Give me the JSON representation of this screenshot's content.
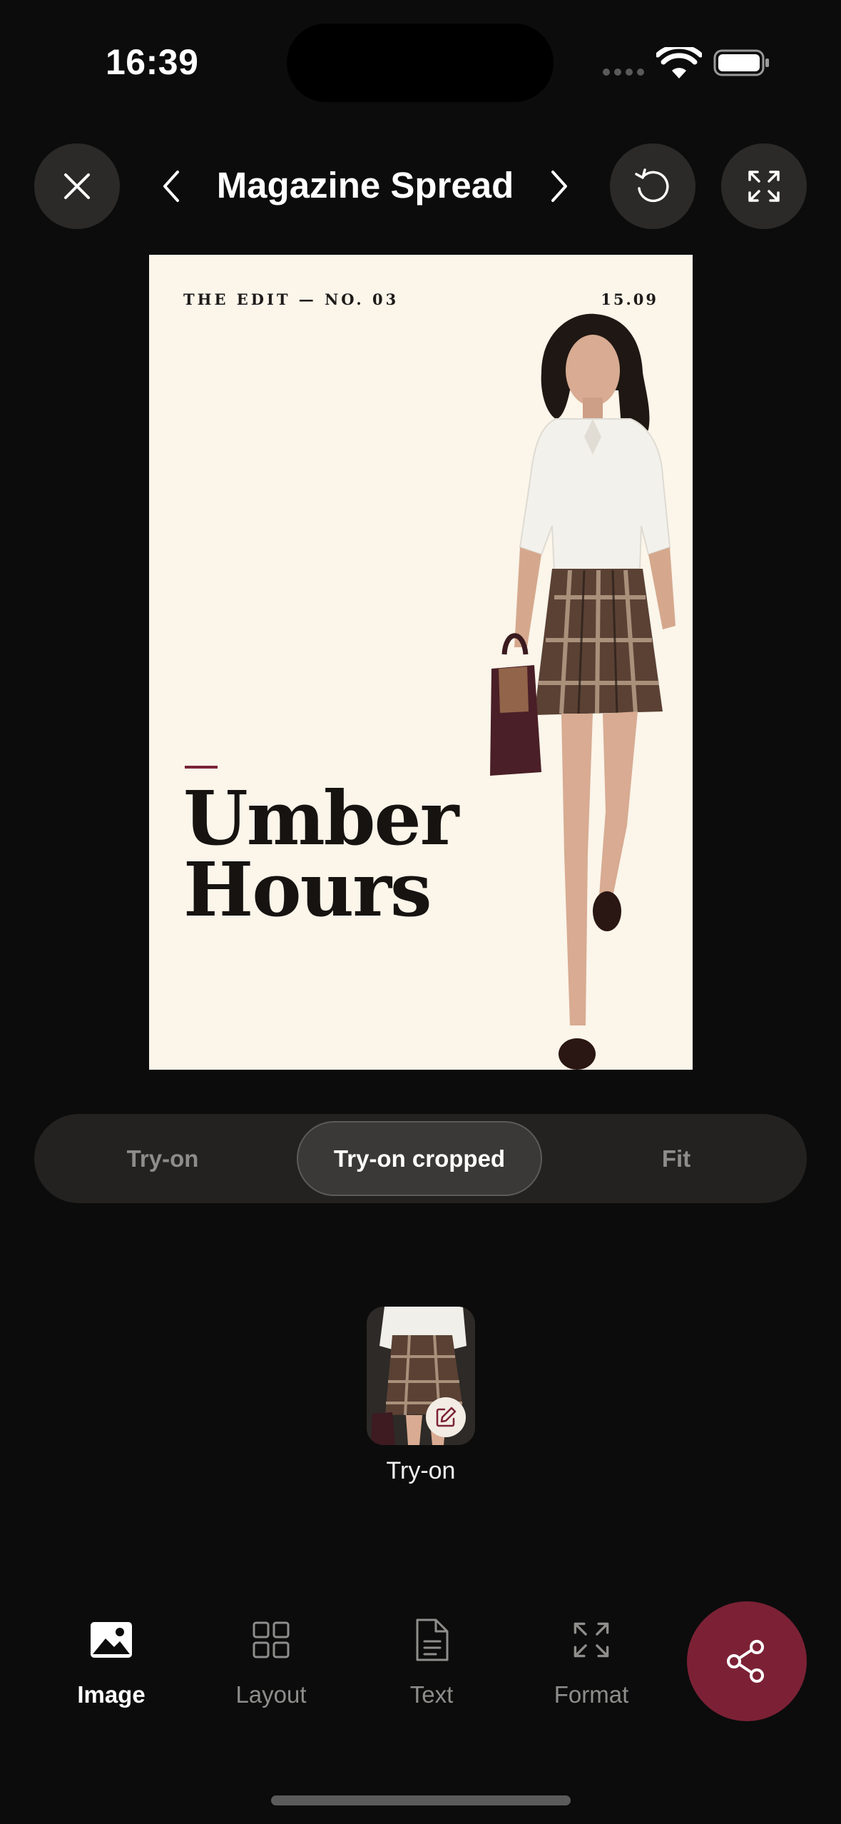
{
  "status_bar": {
    "time": "16:39",
    "icons": [
      "cellular-signal-icon",
      "wifi-icon",
      "battery-icon"
    ]
  },
  "header": {
    "title": "Magazine Spread",
    "icons": [
      "close-icon",
      "chevron-left-icon",
      "chevron-right-icon",
      "undo-icon",
      "expand-icon"
    ]
  },
  "magazine": {
    "issue": "THE EDIT — NO. 03",
    "date": "15.09",
    "headline_line1": "Umber",
    "headline_line2": "Hours",
    "accent_color": "#7a2436",
    "background_color": "#fbf5ea"
  },
  "segmented": {
    "options": [
      "Try-on",
      "Try-on cropped",
      "Fit"
    ],
    "selected": "Try-on cropped"
  },
  "variant": {
    "label": "Try-on",
    "badge_icon": "edit-icon"
  },
  "toolbar": {
    "items": [
      {
        "label": "Image",
        "icon": "image-icon",
        "active": true
      },
      {
        "label": "Layout",
        "icon": "grid-icon",
        "active": false
      },
      {
        "label": "Text",
        "icon": "document-icon",
        "active": false
      },
      {
        "label": "Format",
        "icon": "expand-icon",
        "active": false
      }
    ],
    "share_icon": "share-icon",
    "share_color": "#7c2135"
  }
}
